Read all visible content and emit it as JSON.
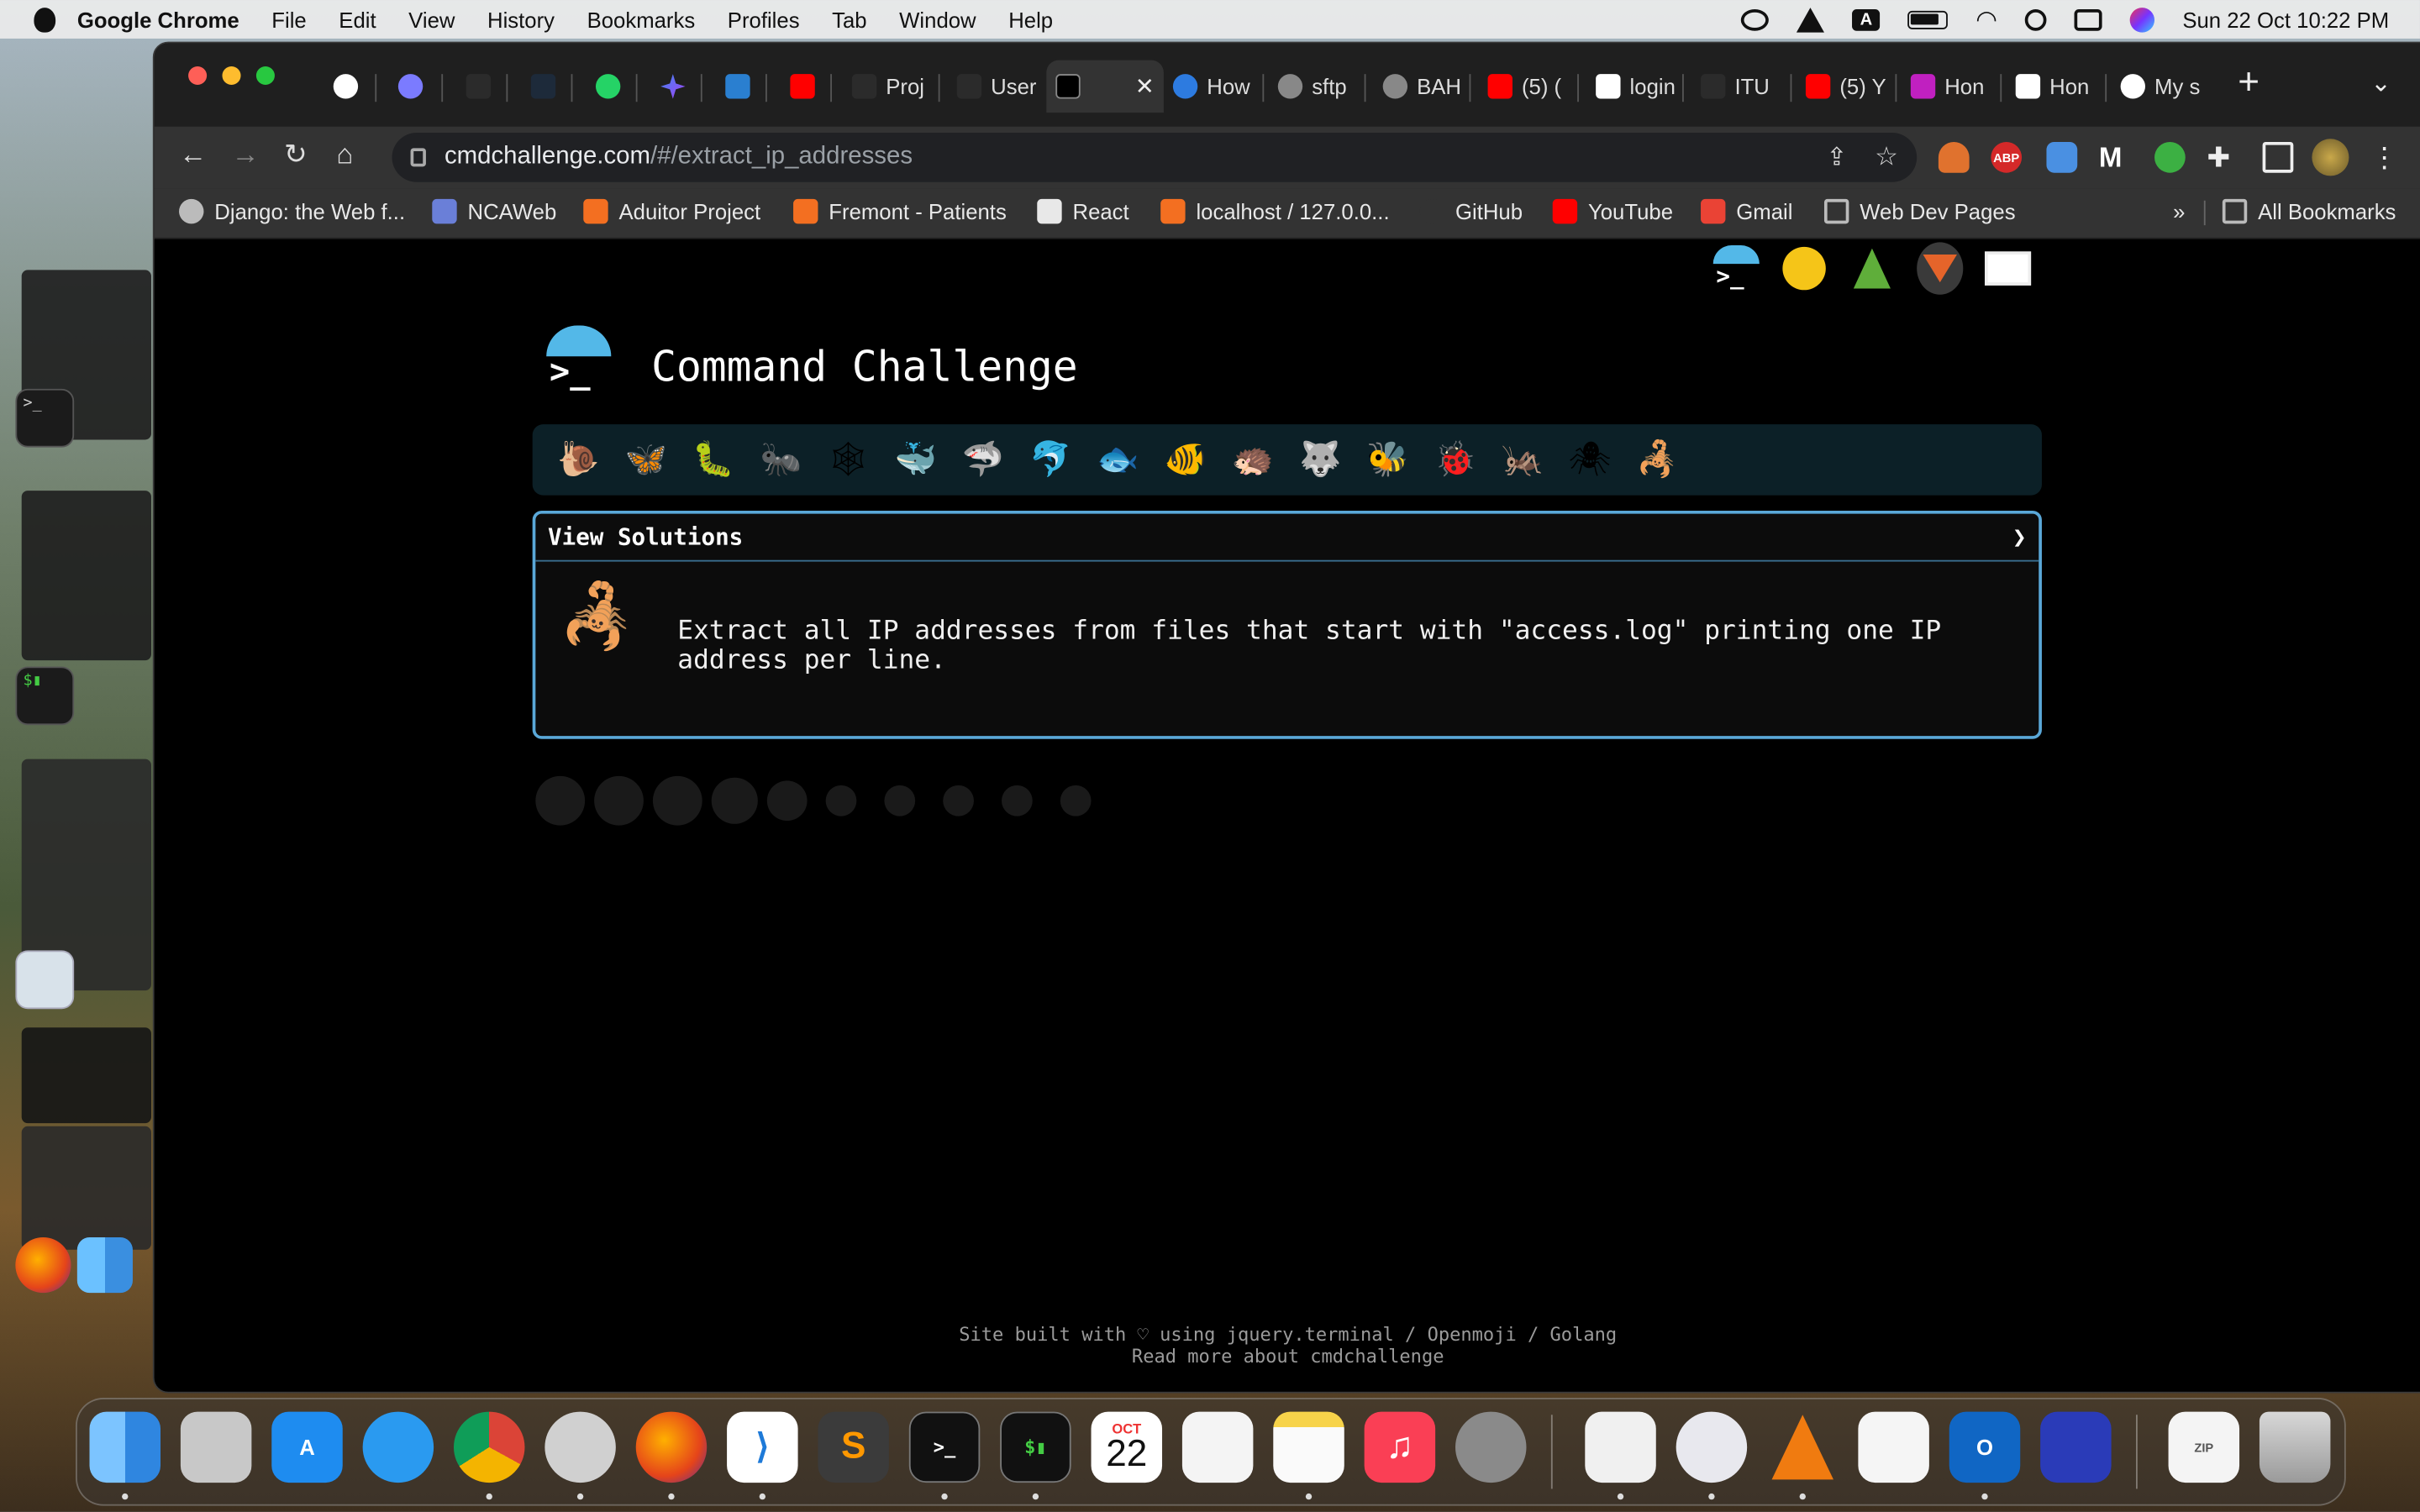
{
  "menubar": {
    "app": "Google Chrome",
    "items": [
      "File",
      "Edit",
      "View",
      "History",
      "Bookmarks",
      "Profiles",
      "Tab",
      "Window",
      "Help"
    ],
    "datetime": "Sun 22 Oct  10:22 PM",
    "input_badge": "A"
  },
  "tabs": [
    {
      "label": "",
      "icon": "github-icon"
    },
    {
      "label": "",
      "icon": "extension-icon"
    },
    {
      "label": "",
      "icon": "blank-tab-icon"
    },
    {
      "label": "",
      "icon": "blank-tab-icon"
    },
    {
      "label": "",
      "icon": "whatsapp-icon"
    },
    {
      "label": "",
      "icon": "gemini-icon"
    },
    {
      "label": "",
      "icon": "site-icon"
    },
    {
      "label": "",
      "icon": "youtube-icon"
    },
    {
      "label": "Proj",
      "icon": "site-icon"
    },
    {
      "label": "User",
      "icon": "site-icon"
    },
    {
      "label": "",
      "icon": "terminal-icon",
      "active": true
    },
    {
      "label": "How",
      "icon": "site-icon"
    },
    {
      "label": "sftp",
      "icon": "globe-icon"
    },
    {
      "label": "BAH",
      "icon": "globe-icon"
    },
    {
      "label": "(5) (",
      "icon": "youtube-icon"
    },
    {
      "label": "login",
      "icon": "doc-icon"
    },
    {
      "label": "ITU",
      "icon": "site-icon"
    },
    {
      "label": "(5) Y",
      "icon": "youtube-icon"
    },
    {
      "label": "Hon",
      "icon": "site-icon"
    },
    {
      "label": "Hon",
      "icon": "site-icon"
    },
    {
      "label": "My s",
      "icon": "medium-icon"
    }
  ],
  "address": {
    "host": "cmdchallenge.com",
    "path": "/#/extract_ip_addresses"
  },
  "bookmarks": [
    {
      "label": "Django: the Web f...",
      "icon": "django-icon",
      "color": "#e8e8e8"
    },
    {
      "label": "NCAWeb",
      "icon": "lock-icon",
      "color": "#6a7fd8"
    },
    {
      "label": "Aduitor Project",
      "icon": "xampp-icon",
      "color": "#f36f21"
    },
    {
      "label": "Fremont - Patients",
      "icon": "xampp-icon",
      "color": "#f36f21"
    },
    {
      "label": "React",
      "icon": "react-icon",
      "color": "#e8e8e8"
    },
    {
      "label": "localhost / 127.0.0...",
      "icon": "xampp-icon",
      "color": "#f36f21"
    },
    {
      "label": "GitHub",
      "icon": "github-icon",
      "color": "#333"
    },
    {
      "label": "YouTube",
      "icon": "youtube-icon",
      "color": "#ff0000"
    },
    {
      "label": "Gmail",
      "icon": "gmail-icon",
      "color": "#ea4335"
    },
    {
      "label": "Web Dev  Pages",
      "icon": "folder-icon",
      "color": "#bbb"
    }
  ],
  "bookmarks_overflow": "»",
  "all_bookmarks": "All Bookmarks",
  "page": {
    "title": "Command Challenge",
    "prompt_glyph": ">_",
    "panel_header": "View Solutions",
    "panel_chevron": "❯",
    "description": "Extract all IP addresses from files that start with \"access.log\" printing one IP address per line.",
    "footer_line1": "Site built with ♡ using jquery.terminal / Openmoji / Golang",
    "footer_line2": "Read more about cmdchallenge",
    "level_icons": [
      "🐌",
      "🦋",
      "🐛",
      "🐜",
      "🕸",
      "🐳",
      "🦈",
      "🐬",
      "🐟",
      "🐠",
      "🦔",
      "🐺",
      "🐝",
      "🐞",
      "🦗",
      "🕷",
      "🦂"
    ],
    "top_icons": [
      "terminal-icon",
      "shush-face-icon",
      "tree-icon",
      "gitlab-icon",
      "mail-icon"
    ]
  },
  "dock": {
    "calendar_month": "OCT",
    "calendar_day": "22"
  },
  "colors": {
    "accent": "#53b8e8",
    "panel_border": "#5aa8d8",
    "levels_bg": "#0c2027"
  }
}
